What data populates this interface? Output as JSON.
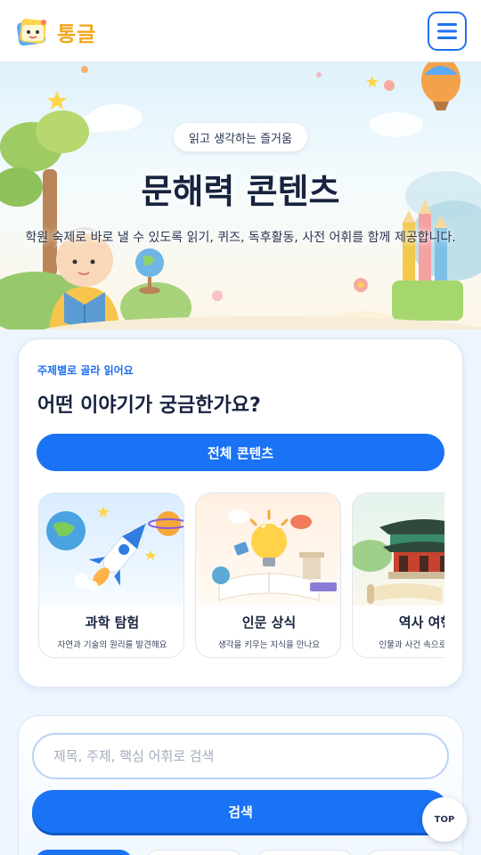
{
  "header": {
    "logo_text": "통글",
    "logo_icon": "book-mascot-logo",
    "menu_icon": "hamburger-menu-icon"
  },
  "hero": {
    "badge": "읽고 생각하는 즐거움",
    "title": "문해력 콘텐츠",
    "description": "학원 숙제로 바로 낼 수 있도록 읽기, 퀴즈, 독후활동, 사전 어휘를 함께 제공합니다."
  },
  "topics": {
    "kicker": "주제별로 골라 읽어요",
    "title": "어떤 이야기가 궁금한가요?",
    "all_button": "전체 콘텐츠",
    "categories": [
      {
        "name": "과학 탐험",
        "desc": "자연과 기술의 원리를 발견해요",
        "icon": "rocket-planet-icon"
      },
      {
        "name": "인문 상식",
        "desc": "생각을 키우는 지식을 만나요",
        "icon": "lightbulb-book-icon"
      },
      {
        "name": "역사 여행",
        "desc": "인물과 사건 속으로 떠나요",
        "icon": "palace-scroll-icon"
      }
    ]
  },
  "search": {
    "placeholder": "제목, 주제, 핵심 어휘로 검색",
    "value": "",
    "button": "검색"
  },
  "top_button": "TOP",
  "colors": {
    "accent": "#1a73f5",
    "logo": "#f2a619",
    "title": "#17233f"
  }
}
